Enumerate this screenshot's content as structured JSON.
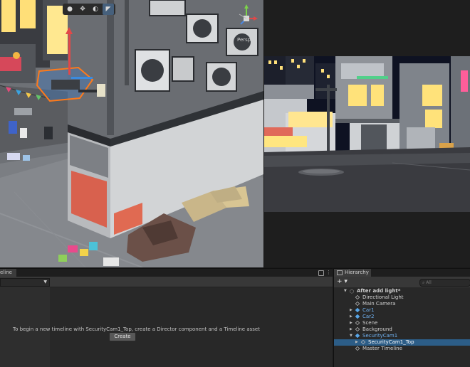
{
  "scene_view": {
    "toolbar_tools": [
      "hand-tool",
      "move-tool",
      "rotate-tool",
      "scale-tool"
    ],
    "projection_label": "Persp",
    "colors": {
      "selection_outline": "#ff7a1a",
      "window_glow": "#ffe68a"
    }
  },
  "game_view": {
    "colors": {
      "sky": "#0d1020",
      "street": "#3a3b40"
    }
  },
  "timeline": {
    "tab_label": "eline",
    "dropdown_value": "",
    "empty_message": "To begin a new timeline with SecurityCam1_Top, create a Director component and a Timeline asset",
    "create_button": "Create"
  },
  "hierarchy": {
    "tab_label": "Hierarchy",
    "add_label": "+ ▾",
    "search_placeholder": "All",
    "items": [
      {
        "label": "After add light*",
        "depth": 0,
        "arrow": "down",
        "icon": "scene",
        "bold": true,
        "blue": false,
        "selected": false
      },
      {
        "label": "Directional Light",
        "depth": 1,
        "arrow": "",
        "icon": "cube",
        "bold": false,
        "blue": false,
        "selected": false
      },
      {
        "label": "Main Camera",
        "depth": 1,
        "arrow": "",
        "icon": "cube",
        "bold": false,
        "blue": false,
        "selected": false
      },
      {
        "label": "Car1",
        "depth": 1,
        "arrow": "right",
        "icon": "prefab",
        "bold": false,
        "blue": true,
        "selected": false
      },
      {
        "label": "Car2",
        "depth": 1,
        "arrow": "right",
        "icon": "prefab",
        "bold": false,
        "blue": true,
        "selected": false
      },
      {
        "label": "Scene",
        "depth": 1,
        "arrow": "right",
        "icon": "cube",
        "bold": false,
        "blue": false,
        "selected": false
      },
      {
        "label": "Background",
        "depth": 1,
        "arrow": "right",
        "icon": "cube",
        "bold": false,
        "blue": false,
        "selected": false
      },
      {
        "label": "SecurityCam1",
        "depth": 1,
        "arrow": "down",
        "icon": "prefab",
        "bold": false,
        "blue": true,
        "selected": false
      },
      {
        "label": "SecurityCam1_Top",
        "depth": 2,
        "arrow": "right",
        "icon": "cube",
        "bold": false,
        "blue": false,
        "selected": true
      },
      {
        "label": "Master Timeline",
        "depth": 1,
        "arrow": "",
        "icon": "cube",
        "bold": false,
        "blue": false,
        "selected": false
      }
    ]
  }
}
